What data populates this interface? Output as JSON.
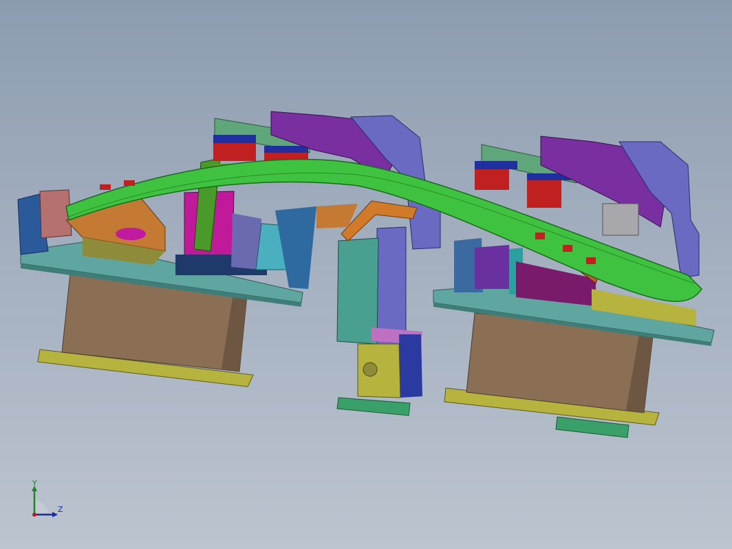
{
  "viewport": {
    "background_top": "#8c9cb0",
    "background_bottom": "#bcc4cf"
  },
  "model": {
    "description_colors": {
      "green_part": "#3fc23f",
      "base_plate": "#5fa6a0",
      "yellow_plate": "#b7b33f",
      "brown_block": "#8a6f55",
      "purple_clamp": "#7a2fa0",
      "lavender_clamp": "#6a6ac2",
      "red_pad": "#c02020",
      "blue_pad": "#1f2fa0",
      "magenta_part": "#c01a9a",
      "orange_part": "#d07a2a"
    }
  },
  "triad": {
    "y_label": "Y",
    "z_label": "Z",
    "y_color": "#1a8a1a",
    "z_color": "#1a2aa0",
    "origin_color": "#c01a1a"
  }
}
